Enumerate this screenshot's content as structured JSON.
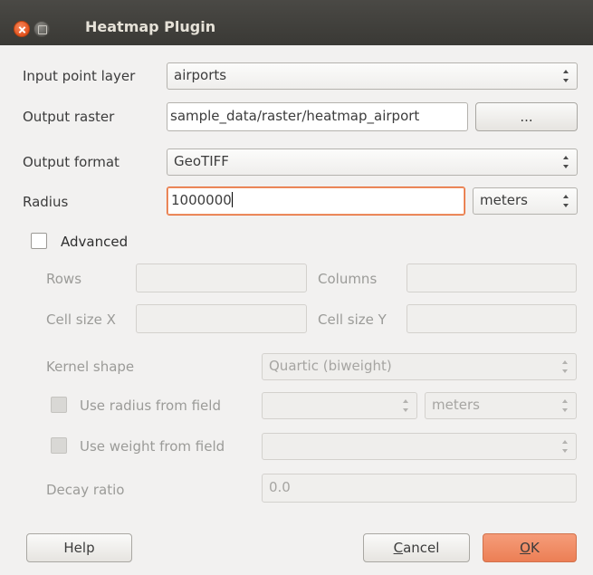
{
  "window": {
    "title": "Heatmap Plugin"
  },
  "form": {
    "input_layer": {
      "label": "Input point layer",
      "value": "airports"
    },
    "output_raster": {
      "label": "Output raster",
      "value": "sample_data/raster/heatmap_airport",
      "browse_label": "..."
    },
    "output_format": {
      "label": "Output format",
      "value": "GeoTIFF"
    },
    "radius": {
      "label": "Radius",
      "value": "1000000",
      "unit": "meters"
    }
  },
  "advanced": {
    "label": "Advanced",
    "checked": false,
    "rows": {
      "label": "Rows",
      "value": ""
    },
    "columns": {
      "label": "Columns",
      "value": ""
    },
    "cell_size_x": {
      "label": "Cell size X",
      "value": ""
    },
    "cell_size_y": {
      "label": "Cell size Y",
      "value": ""
    },
    "kernel_shape": {
      "label": "Kernel shape",
      "value": "Quartic (biweight)"
    },
    "radius_from_field": {
      "label": "Use radius from field",
      "field": "",
      "unit": "meters"
    },
    "weight_from_field": {
      "label": "Use weight from field",
      "field": ""
    },
    "decay_ratio": {
      "label": "Decay ratio",
      "value": "0.0"
    }
  },
  "buttons": {
    "help": "Help",
    "cancel_pre": "",
    "cancel_mnemonic": "C",
    "cancel_rest": "ancel",
    "ok_mnemonic": "O",
    "ok_rest": "K"
  },
  "colors": {
    "titlebar": "#3c3b37",
    "accent": "#ee8459",
    "focus_border": "#e66b34"
  }
}
